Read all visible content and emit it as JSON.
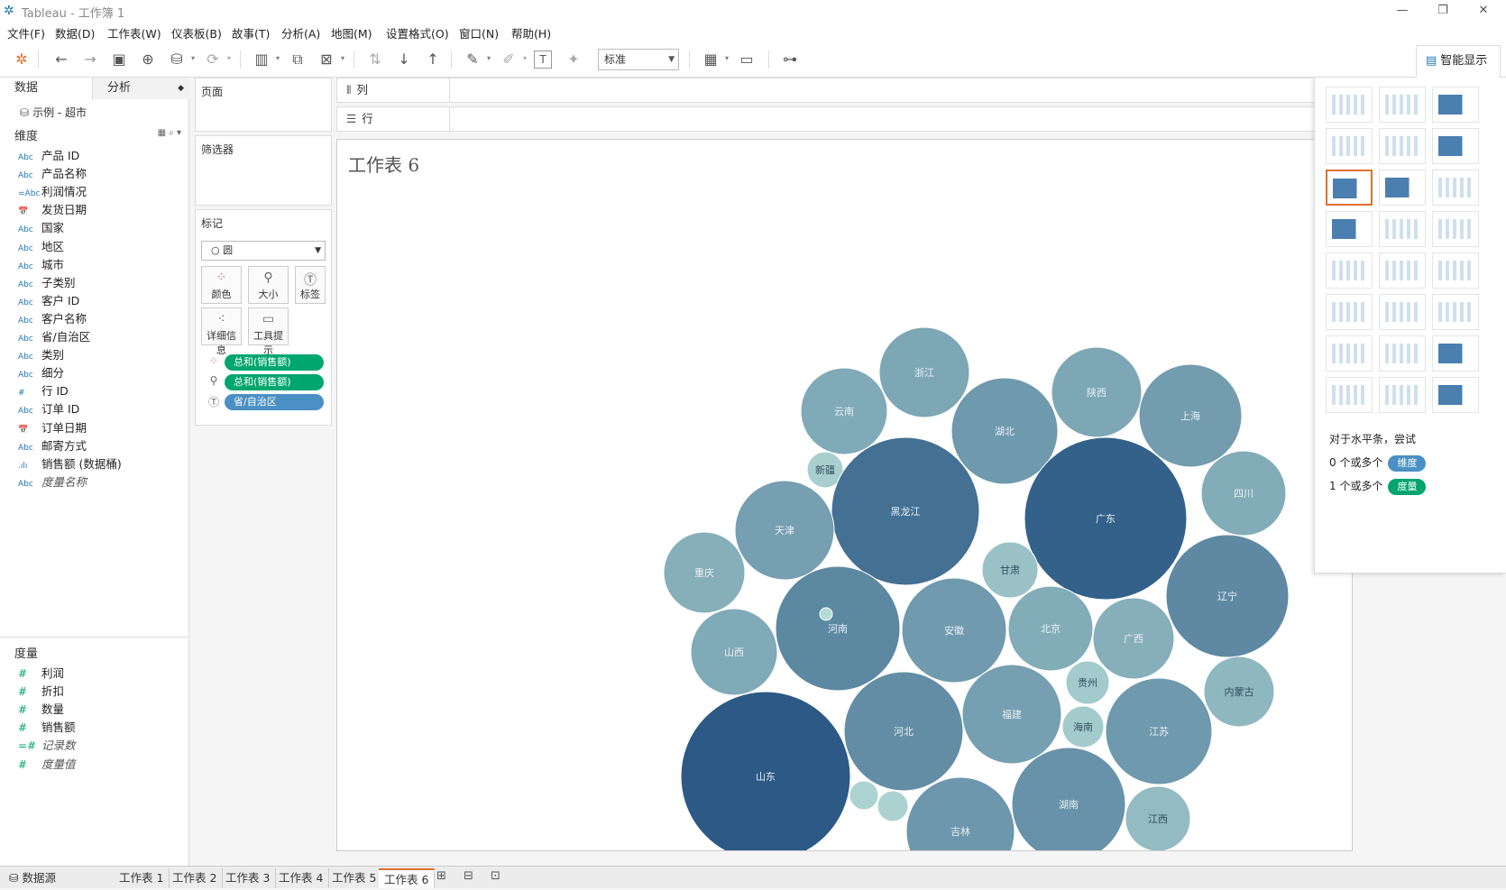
{
  "window": {
    "title": "Tableau - 工作簿 1",
    "minimize": "—",
    "restore": "❐",
    "close": "✕"
  },
  "menu": [
    "文件(F)",
    "数据(D)",
    "工作表(W)",
    "仪表板(B)",
    "故事(T)",
    "分析(A)",
    "地图(M)",
    "设置格式(O)",
    "窗口(N)",
    "帮助(H)"
  ],
  "toolbar": {
    "fit_select": "标准",
    "show_me": "智能显示"
  },
  "data_pane": {
    "tab_data": "数据",
    "tab_analysis": "分析",
    "datasource": "示例 - 超市",
    "dimensions_label": "维度",
    "dimensions": [
      {
        "type": "Abc",
        "name": "产品 ID"
      },
      {
        "type": "Abc",
        "name": "产品名称"
      },
      {
        "type": "=Abc",
        "name": "利润情况"
      },
      {
        "type": "date",
        "name": "发货日期"
      },
      {
        "type": "Abc",
        "name": "国家"
      },
      {
        "type": "Abc",
        "name": "地区"
      },
      {
        "type": "Abc",
        "name": "城市"
      },
      {
        "type": "Abc",
        "name": "子类别"
      },
      {
        "type": "Abc",
        "name": "客户 ID"
      },
      {
        "type": "Abc",
        "name": "客户名称"
      },
      {
        "type": "Abc",
        "name": "省/自治区"
      },
      {
        "type": "Abc",
        "name": "类别"
      },
      {
        "type": "Abc",
        "name": "细分"
      },
      {
        "type": "#",
        "name": "行 ID"
      },
      {
        "type": "Abc",
        "name": "订单 ID"
      },
      {
        "type": "date",
        "name": "订单日期"
      },
      {
        "type": "Abc",
        "name": "邮寄方式"
      },
      {
        "type": "bin",
        "name": "销售额 (数据桶)"
      },
      {
        "type": "Abc",
        "name": "度量名称",
        "italic": true
      }
    ],
    "measures_label": "度量",
    "measures": [
      {
        "type": "#",
        "name": "利润"
      },
      {
        "type": "#",
        "name": "折扣"
      },
      {
        "type": "#",
        "name": "数量"
      },
      {
        "type": "#",
        "name": "销售额"
      },
      {
        "type": "=#",
        "name": "记录数",
        "italic": true
      },
      {
        "type": "#",
        "name": "度量值",
        "italic": true
      }
    ]
  },
  "cards": {
    "pages": "页面",
    "filters": "筛选器",
    "marks": "标记",
    "mark_type": "圆",
    "buttons": [
      "颜色",
      "大小",
      "标签",
      "详细信息",
      "工具提示"
    ],
    "pills": [
      {
        "icon": "color",
        "label": "总和(销售额)"
      },
      {
        "icon": "size",
        "label": "总和(销售额)"
      },
      {
        "icon": "label",
        "label": "省/自治区"
      }
    ]
  },
  "shelves": {
    "columns": "列",
    "rows": "行"
  },
  "worksheet": {
    "title": "工作表 6"
  },
  "chart_data": {
    "type": "bubble",
    "title": "工作表 6",
    "label_field": "省/自治区",
    "size_field": "总和(销售额)",
    "color_field": "总和(销售额)",
    "labeled": [
      "浙江",
      "云南",
      "湖北",
      "陕西",
      "上海",
      "新疆",
      "黑龙江",
      "广东",
      "四川",
      "天津",
      "甘肃",
      "重庆",
      "辽宁",
      "河南",
      "安徽",
      "北京",
      "广西",
      "山西",
      "贵州",
      "内蒙古",
      "福建",
      "河北",
      "海南",
      "江苏",
      "山东",
      "湖南",
      "江西",
      "吉林"
    ],
    "color_low": "#b8ded8",
    "color_high": "#2c5985"
  },
  "show_me": {
    "hint": "对于水平条，尝试",
    "req1_prefix": "0 个或多个",
    "req1_badge": "维度",
    "req2_prefix": "1 个或多个",
    "req2_badge": "度量",
    "dim_color": "#4a90c4",
    "meas_color": "#00a66e"
  },
  "status": {
    "datasource": "数据源",
    "sheets": [
      "工作表 1",
      "工作表 2",
      "工作表 3",
      "工作表 4",
      "工作表 5",
      "工作表 6"
    ],
    "active": "工作表 6"
  }
}
